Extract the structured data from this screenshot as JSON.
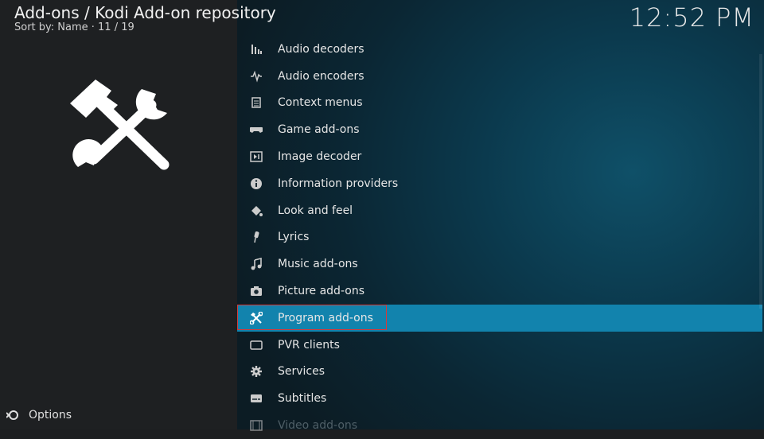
{
  "header": {
    "title": "Add-ons / Kodi Add-on repository",
    "subtitle": "Sort by: Name  ·  11 / 19"
  },
  "clock": "12:52 PM",
  "options_label": "Options",
  "colors": {
    "accent": "#1283ad",
    "highlight_outline": "#d43a3a"
  },
  "categories": [
    {
      "label": "Audio decoders",
      "icon": "audio-decoder-icon"
    },
    {
      "label": "Audio encoders",
      "icon": "audio-encoder-icon"
    },
    {
      "label": "Context menus",
      "icon": "context-menu-icon"
    },
    {
      "label": "Game add-ons",
      "icon": "gamepad-icon"
    },
    {
      "label": "Image decoder",
      "icon": "image-decoder-icon"
    },
    {
      "label": "Information providers",
      "icon": "info-icon"
    },
    {
      "label": "Look and feel",
      "icon": "paint-bucket-icon"
    },
    {
      "label": "Lyrics",
      "icon": "microphone-icon"
    },
    {
      "label": "Music add-ons",
      "icon": "music-note-icon"
    },
    {
      "label": "Picture add-ons",
      "icon": "camera-icon"
    },
    {
      "label": "Program add-ons",
      "icon": "tools-icon",
      "selected": true
    },
    {
      "label": "PVR clients",
      "icon": "tv-icon"
    },
    {
      "label": "Services",
      "icon": "gear-icon"
    },
    {
      "label": "Subtitles",
      "icon": "subtitles-icon"
    },
    {
      "label": "Video add-ons",
      "icon": "film-icon"
    }
  ]
}
